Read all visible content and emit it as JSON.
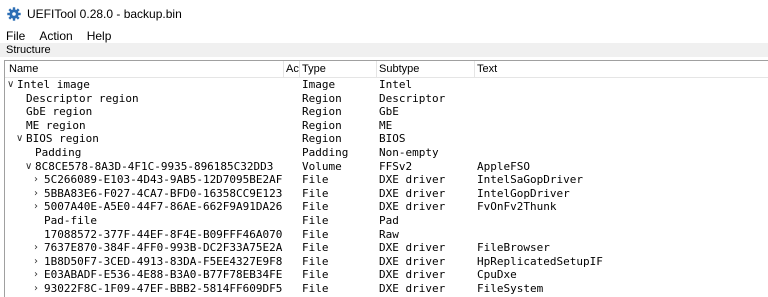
{
  "window": {
    "title": "UEFITool 0.28.0 - backup.bin",
    "app_icon": "gear-icon"
  },
  "menu": [
    "File",
    "Action",
    "Help"
  ],
  "panel": {
    "title": "Structure"
  },
  "columns": {
    "name": "Name",
    "action": "Ac",
    "type": "Type",
    "subtype": "Subtype",
    "text": "Text"
  },
  "rows": [
    {
      "level": 0,
      "expander": "down",
      "name": "Intel image",
      "type": "Image",
      "subtype": "Intel",
      "text": ""
    },
    {
      "level": 1,
      "expander": "none",
      "name": "Descriptor region",
      "type": "Region",
      "subtype": "Descriptor",
      "text": ""
    },
    {
      "level": 1,
      "expander": "none",
      "name": "GbE region",
      "type": "Region",
      "subtype": "GbE",
      "text": ""
    },
    {
      "level": 1,
      "expander": "none",
      "name": "ME region",
      "type": "Region",
      "subtype": "ME",
      "text": ""
    },
    {
      "level": 1,
      "expander": "down",
      "name": "BIOS region",
      "type": "Region",
      "subtype": "BIOS",
      "text": ""
    },
    {
      "level": 2,
      "expander": "none",
      "name": "Padding",
      "type": "Padding",
      "subtype": "Non-empty",
      "text": ""
    },
    {
      "level": 2,
      "expander": "down",
      "name": "8C8CE578-8A3D-4F1C-9935-896185C32DD3",
      "type": "Volume",
      "subtype": "FFSv2",
      "text": "AppleFSO"
    },
    {
      "level": 3,
      "expander": "right",
      "name": "5C266089-E103-4D43-9AB5-12D7095BE2AF",
      "type": "File",
      "subtype": "DXE driver",
      "text": "IntelSaGopDriver"
    },
    {
      "level": 3,
      "expander": "right",
      "name": "5BBA83E6-F027-4CA7-BFD0-16358CC9E123",
      "type": "File",
      "subtype": "DXE driver",
      "text": "IntelGopDriver"
    },
    {
      "level": 3,
      "expander": "right",
      "name": "5007A40E-A5E0-44F7-86AE-662F9A91DA26",
      "type": "File",
      "subtype": "DXE driver",
      "text": "FvOnFv2Thunk"
    },
    {
      "level": 3,
      "expander": "none",
      "name": "Pad-file",
      "type": "File",
      "subtype": "Pad",
      "text": ""
    },
    {
      "level": 3,
      "expander": "none",
      "name": "17088572-377F-44EF-8F4E-B09FFF46A070",
      "type": "File",
      "subtype": "Raw",
      "text": ""
    },
    {
      "level": 3,
      "expander": "right",
      "name": "7637E870-384F-4FF0-993B-DC2F33A75E2A",
      "type": "File",
      "subtype": "DXE driver",
      "text": "FileBrowser"
    },
    {
      "level": 3,
      "expander": "right",
      "name": "1B8D50F7-3CED-4913-83DA-F5EE4327E9F8",
      "type": "File",
      "subtype": "DXE driver",
      "text": "HpReplicatedSetupIF"
    },
    {
      "level": 3,
      "expander": "right",
      "name": "E03ABADF-E536-4E88-B3A0-B77F78EB34FE",
      "type": "File",
      "subtype": "DXE driver",
      "text": "CpuDxe"
    },
    {
      "level": 3,
      "expander": "right",
      "name": "93022F8C-1F09-47EF-BBB2-5814FF609DF5",
      "type": "File",
      "subtype": "DXE driver",
      "text": "FileSystem"
    }
  ]
}
